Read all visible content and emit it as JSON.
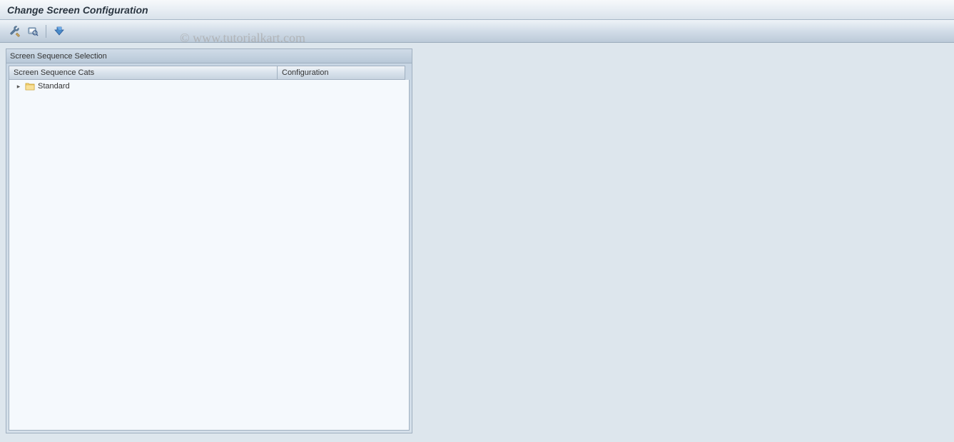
{
  "title": "Change Screen Configuration",
  "toolbar": {
    "btn1_name": "tools-icon",
    "btn2_name": "print-preview-icon",
    "btn3_name": "display-icon"
  },
  "panel": {
    "header": "Screen Sequence Selection",
    "columns": {
      "cats": "Screen Sequence Cats",
      "config": "Configuration"
    },
    "tree": {
      "items": [
        {
          "label": "Standard"
        }
      ]
    }
  },
  "watermark": "© www.tutorialkart.com"
}
